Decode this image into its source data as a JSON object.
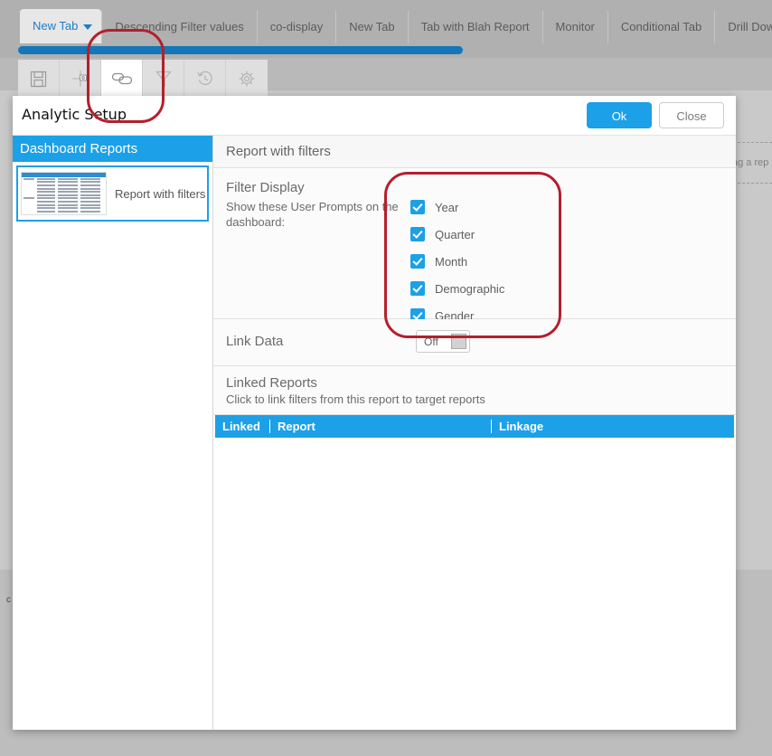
{
  "tabs": [
    {
      "label": "New Tab",
      "active": true
    },
    {
      "label": "Descending Filter values",
      "active": false
    },
    {
      "label": "co-display",
      "active": false
    },
    {
      "label": "New Tab",
      "active": false
    },
    {
      "label": "Tab with Blah Report",
      "active": false
    },
    {
      "label": "Monitor",
      "active": false
    },
    {
      "label": "Conditional Tab",
      "active": false
    },
    {
      "label": "Drill Down param",
      "active": false
    }
  ],
  "toolbar": {
    "buttons": [
      {
        "icon": "save-icon",
        "active": false
      },
      {
        "icon": "add-report-icon",
        "active": false
      },
      {
        "icon": "link-icon",
        "active": true
      },
      {
        "icon": "filter-icon",
        "active": false
      },
      {
        "icon": "history-icon",
        "active": false
      },
      {
        "icon": "settings-gear-icon",
        "active": false
      }
    ]
  },
  "canvas": {
    "dropzone_text": "ag a rep",
    "corner_glyph": "c"
  },
  "dialog": {
    "title": "Analytic Setup",
    "ok_label": "Ok",
    "close_label": "Close",
    "sidebar": {
      "title": "Dashboard Reports",
      "items": [
        {
          "label": "Report with filters",
          "selected": true
        }
      ]
    },
    "main": {
      "section_title": "Report with filters",
      "filter_display": {
        "heading": "Filter Display",
        "subtitle": "Show these User Prompts on the dashboard:",
        "checkboxes": [
          {
            "label": "Year",
            "checked": true
          },
          {
            "label": "Quarter",
            "checked": true
          },
          {
            "label": "Month",
            "checked": true
          },
          {
            "label": "Demographic",
            "checked": true
          },
          {
            "label": "Gender",
            "checked": true
          }
        ]
      },
      "link_data": {
        "label": "Link Data",
        "toggle_state": "Off"
      },
      "linked_reports": {
        "heading": "Linked Reports",
        "subtitle": "Click to link filters from this report to target reports",
        "columns": [
          "Linked",
          "Report",
          "Linkage"
        ],
        "rows": []
      }
    }
  },
  "colors": {
    "accent_blue": "#1ca0e8",
    "progress_blue": "#1577b8",
    "annotation_red": "#b51f2c",
    "tab_active_text": "#1b7fc4"
  }
}
